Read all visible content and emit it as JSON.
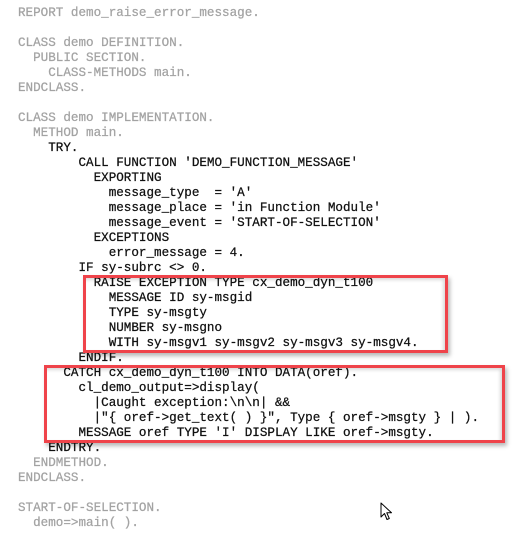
{
  "editor": {
    "language": "ABAP",
    "lines": [
      {
        "text": "REPORT demo_raise_error_message.",
        "style": "dim"
      },
      {
        "text": "",
        "style": "dim"
      },
      {
        "text": "CLASS demo DEFINITION.",
        "style": "dim"
      },
      {
        "text": "  PUBLIC SECTION.",
        "style": "dim"
      },
      {
        "text": "    CLASS-METHODS main.",
        "style": "dim"
      },
      {
        "text": "ENDCLASS.",
        "style": "dim"
      },
      {
        "text": "",
        "style": "dim"
      },
      {
        "text": "CLASS demo IMPLEMENTATION.",
        "style": "dim"
      },
      {
        "text": "  METHOD main.",
        "style": "dim"
      },
      {
        "text": "    TRY.",
        "style": "dark"
      },
      {
        "text": "        CALL FUNCTION 'DEMO_FUNCTION_MESSAGE'",
        "style": "dark"
      },
      {
        "text": "          EXPORTING",
        "style": "dark"
      },
      {
        "text": "            message_type  = 'A'",
        "style": "dark"
      },
      {
        "text": "            message_place = 'in Function Module'",
        "style": "dark"
      },
      {
        "text": "            message_event = 'START-OF-SELECTION'",
        "style": "dark"
      },
      {
        "text": "          EXCEPTIONS",
        "style": "dark"
      },
      {
        "text": "            error_message = 4.",
        "style": "dark"
      },
      {
        "text": "        IF sy-subrc <> 0.",
        "style": "dark"
      },
      {
        "text": "          RAISE EXCEPTION TYPE cx_demo_dyn_t100",
        "style": "dark"
      },
      {
        "text": "            MESSAGE ID sy-msgid",
        "style": "dark"
      },
      {
        "text": "            TYPE sy-msgty",
        "style": "dark"
      },
      {
        "text": "            NUMBER sy-msgno",
        "style": "dark"
      },
      {
        "text": "            WITH sy-msgv1 sy-msgv2 sy-msgv3 sy-msgv4.",
        "style": "dark"
      },
      {
        "text": "        ENDIF.",
        "style": "dark"
      },
      {
        "text": "      CATCH cx_demo_dyn_t100 INTO DATA(oref).",
        "style": "dark"
      },
      {
        "text": "        cl_demo_output=>display(",
        "style": "dark"
      },
      {
        "text": "          |Caught exception:\\n\\n| &&",
        "style": "dark"
      },
      {
        "text": "          |\"{ oref->get_text( ) }\", Type { oref->msgty } | ).",
        "style": "dark"
      },
      {
        "text": "        MESSAGE oref TYPE 'I' DISPLAY LIKE oref->msgty.",
        "style": "dark"
      },
      {
        "text": "    ENDTRY.",
        "style": "dark"
      },
      {
        "text": "  ENDMETHOD.",
        "style": "dim"
      },
      {
        "text": "ENDCLASS.",
        "style": "dim"
      },
      {
        "text": "",
        "style": "dim"
      },
      {
        "text": "START-OF-SELECTION.",
        "style": "dim"
      },
      {
        "text": "  demo=>main( ).",
        "style": "dim"
      }
    ]
  },
  "highlights": [
    {
      "label": "raise-exception-block",
      "color": "#ef434a",
      "from_line": 18,
      "to_line": 22
    },
    {
      "label": "catch-block",
      "color": "#ef434a",
      "from_line": 24,
      "to_line": 28
    }
  ],
  "cursor": {
    "icon": "mouse-pointer-arrow"
  }
}
